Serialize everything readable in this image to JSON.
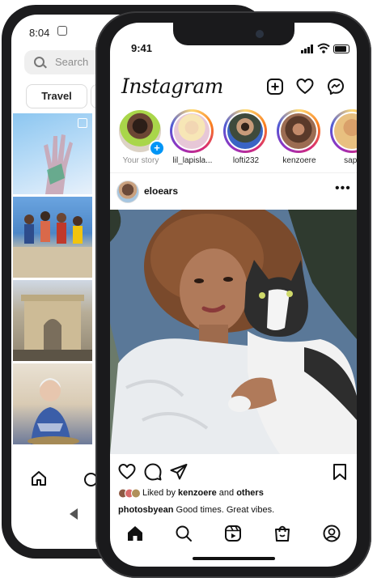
{
  "back_phone": {
    "status_time": "8:04",
    "search_placeholder": "Search",
    "chip_label": "Travel"
  },
  "front_phone": {
    "status_time": "9:41",
    "app_name": "Instagram",
    "stories": [
      {
        "label": "Your story"
      },
      {
        "label": "lil_lapisla..."
      },
      {
        "label": "lofti232"
      },
      {
        "label": "kenzoere"
      },
      {
        "label": "sapp"
      }
    ],
    "post": {
      "username": "eloears",
      "liked_by_prefix": "Liked by ",
      "liked_by_user": "kenzoere",
      "liked_by_and": " and ",
      "liked_by_others": "others",
      "caption_user": "photosbyean",
      "caption_text": " Good times. Great vibes."
    }
  }
}
